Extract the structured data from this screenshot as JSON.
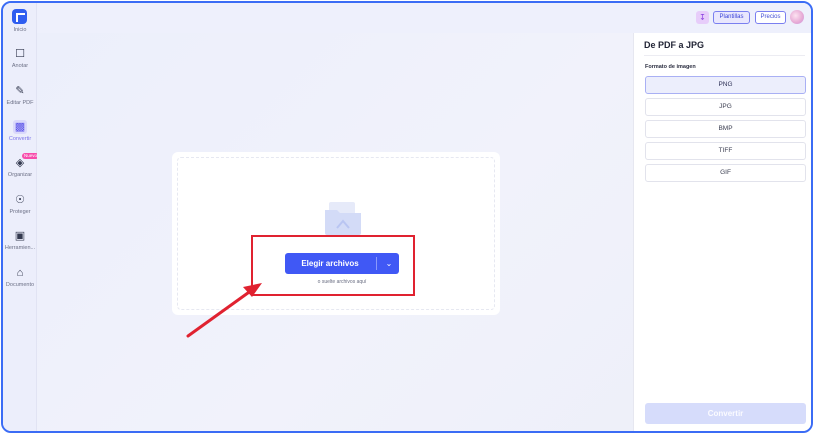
{
  "sidebar": {
    "items": [
      {
        "label": "Inicio",
        "icon": "home-logo-icon"
      },
      {
        "label": "Anotar",
        "icon": "annotate-icon"
      },
      {
        "label": "Editar PDF",
        "icon": "edit-pdf-icon"
      },
      {
        "label": "Convertir",
        "icon": "convert-icon",
        "active": true
      },
      {
        "label": "Organizar",
        "icon": "organize-icon",
        "badge": "Nuevo"
      },
      {
        "label": "Proteger",
        "icon": "shield-icon"
      },
      {
        "label": "Herramien...",
        "icon": "tools-icon"
      },
      {
        "label": "Documento",
        "icon": "document-home-icon"
      }
    ]
  },
  "topbar": {
    "plantillas_label": "Plantillas",
    "precios_label": "Precios"
  },
  "upload": {
    "button_label": "Elegir archivos",
    "drop_hint": "o suelte archivos aquí"
  },
  "panel": {
    "title": "De PDF a JPG",
    "format_label": "Formato de imagen",
    "options": [
      "PNG",
      "JPG",
      "BMP",
      "TIFF",
      "GIF"
    ],
    "selected": "PNG",
    "convert_label": "Convertir"
  },
  "colors": {
    "accent": "#4058f5",
    "frame": "#3b6cf5",
    "annotation": "#e02230"
  }
}
